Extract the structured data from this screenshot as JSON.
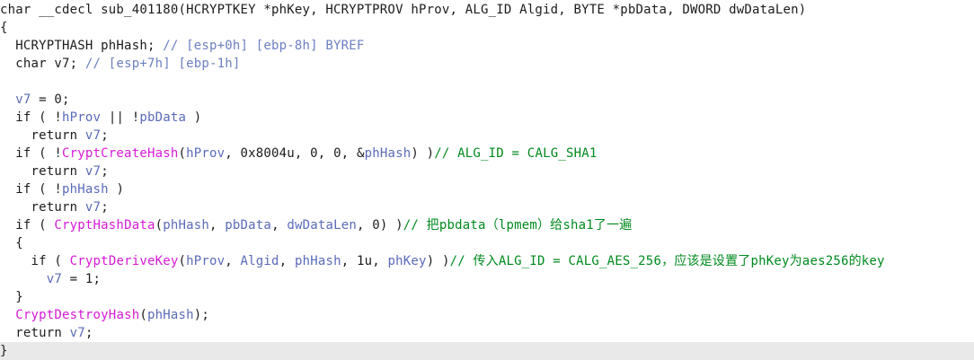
{
  "editor": {
    "current_line_index": 18,
    "lines": [
      [
        {
          "t": "char __cdecl sub_401180(HCRYPTKEY *phKey, HCRYPTPROV hProv, ALG_ID Algid, BYTE *pbData, DWORD dwDataLen)",
          "c": "txt"
        }
      ],
      [
        {
          "t": "{",
          "c": "txt"
        }
      ],
      [
        {
          "t": "  HCRYPTHASH phHash; ",
          "c": "txt"
        },
        {
          "t": "// [esp+0h] [ebp-8h] BYREF",
          "c": "cmr"
        }
      ],
      [
        {
          "t": "  char v7; ",
          "c": "txt"
        },
        {
          "t": "// [esp+7h] [ebp-1h]",
          "c": "cmr"
        }
      ],
      [
        {
          "t": "",
          "c": "txt"
        }
      ],
      [
        {
          "t": "  ",
          "c": "txt"
        },
        {
          "t": "v7",
          "c": "var"
        },
        {
          "t": " = 0;",
          "c": "txt"
        }
      ],
      [
        {
          "t": "  if ( !",
          "c": "txt"
        },
        {
          "t": "hProv",
          "c": "var"
        },
        {
          "t": " || !",
          "c": "txt"
        },
        {
          "t": "pbData",
          "c": "var"
        },
        {
          "t": " )",
          "c": "txt"
        }
      ],
      [
        {
          "t": "    return ",
          "c": "txt"
        },
        {
          "t": "v7",
          "c": "var"
        },
        {
          "t": ";",
          "c": "txt"
        }
      ],
      [
        {
          "t": "  if ( !",
          "c": "txt"
        },
        {
          "t": "CryptCreateHash",
          "c": "api"
        },
        {
          "t": "(",
          "c": "txt"
        },
        {
          "t": "hProv",
          "c": "var"
        },
        {
          "t": ", 0x8004u, 0, 0, &",
          "c": "txt"
        },
        {
          "t": "phHash",
          "c": "var"
        },
        {
          "t": ") )",
          "c": "txt"
        },
        {
          "t": "// ALG_ID = CALG_SHA1",
          "c": "cm"
        }
      ],
      [
        {
          "t": "    return ",
          "c": "txt"
        },
        {
          "t": "v7",
          "c": "var"
        },
        {
          "t": ";",
          "c": "txt"
        }
      ],
      [
        {
          "t": "  if ( !",
          "c": "txt"
        },
        {
          "t": "phHash",
          "c": "var"
        },
        {
          "t": " )",
          "c": "txt"
        }
      ],
      [
        {
          "t": "    return ",
          "c": "txt"
        },
        {
          "t": "v7",
          "c": "var"
        },
        {
          "t": ";",
          "c": "txt"
        }
      ],
      [
        {
          "t": "  if ( ",
          "c": "txt"
        },
        {
          "t": "CryptHashData",
          "c": "api"
        },
        {
          "t": "(",
          "c": "txt"
        },
        {
          "t": "phHash",
          "c": "var"
        },
        {
          "t": ", ",
          "c": "txt"
        },
        {
          "t": "pbData",
          "c": "var"
        },
        {
          "t": ", ",
          "c": "txt"
        },
        {
          "t": "dwDataLen",
          "c": "var"
        },
        {
          "t": ", 0) )",
          "c": "txt"
        },
        {
          "t": "// 把pbdata（lpmem）给sha1了一遍",
          "c": "cm"
        }
      ],
      [
        {
          "t": "  {",
          "c": "txt"
        }
      ],
      [
        {
          "t": "    if ( ",
          "c": "txt"
        },
        {
          "t": "CryptDeriveKey",
          "c": "api"
        },
        {
          "t": "(",
          "c": "txt"
        },
        {
          "t": "hProv",
          "c": "var"
        },
        {
          "t": ", ",
          "c": "txt"
        },
        {
          "t": "Algid",
          "c": "var"
        },
        {
          "t": ", ",
          "c": "txt"
        },
        {
          "t": "phHash",
          "c": "var"
        },
        {
          "t": ", 1u, ",
          "c": "txt"
        },
        {
          "t": "phKey",
          "c": "var"
        },
        {
          "t": ") )",
          "c": "txt"
        },
        {
          "t": "// 传入ALG_ID = CALG_AES_256，应该是设置了phKey为aes256的key",
          "c": "cm"
        }
      ],
      [
        {
          "t": "      ",
          "c": "txt"
        },
        {
          "t": "v7",
          "c": "var"
        },
        {
          "t": " = 1;",
          "c": "txt"
        }
      ],
      [
        {
          "t": "  }",
          "c": "txt"
        }
      ],
      [
        {
          "t": "  ",
          "c": "txt"
        },
        {
          "t": "CryptDestroyHash",
          "c": "api"
        },
        {
          "t": "(",
          "c": "txt"
        },
        {
          "t": "phHash",
          "c": "var"
        },
        {
          "t": ");",
          "c": "txt"
        }
      ],
      [
        {
          "t": "  return ",
          "c": "txt"
        },
        {
          "t": "v7",
          "c": "var"
        },
        {
          "t": ";",
          "c": "txt"
        }
      ],
      [
        {
          "t": "}",
          "c": "txt"
        }
      ]
    ]
  }
}
